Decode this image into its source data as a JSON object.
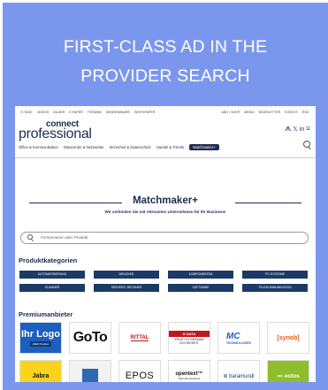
{
  "headline": {
    "line1": "FIRST-CLASS AD IN THE",
    "line2": "PROVIDER SEARCH"
  },
  "site": {
    "top_left": [
      "IT-TAGE",
      "VIDEOS",
      "BILDER",
      "E-PAPER",
      "TERMINE",
      "WEBSEMINARE",
      "WHITEPAPER"
    ],
    "top_right": [
      "ABO / SHOP",
      "MEDIA",
      "NEWSLETTER",
      "EVENTS",
      "RSS"
    ],
    "logo_top": "connect",
    "logo_bottom": "professional",
    "social": "⨇ 𝕏 in ✉",
    "nav": [
      "Office & Kommunikation",
      "Datacenter & Netzwerke",
      "Sicherheit & Datenschutz",
      "Handel & Trends",
      "Matchmaker+"
    ]
  },
  "matchmaker": {
    "title": "Matchmaker+",
    "subtitle": "Wir verbinden Sie mit relevanten Unternehmen für Ihr Business!",
    "search_placeholder": "Firmenname oder Produkt"
  },
  "categories": {
    "heading": "Produktkategorien",
    "items": [
      "AUTOMATISIERUNG",
      "DRUCKER",
      "KOMPONENTEN",
      "PC SYSTEME",
      "SCANNER",
      "SERVERS, RECHNER",
      "SOFTWARE",
      "TELEKOMMUNIKATION"
    ]
  },
  "premium": {
    "heading": "Premiumanbieter",
    "logos": {
      "ihr_logo": "Ihr Logo",
      "ihr_logo_sub": "HIER Position",
      "goto": "GoTo",
      "rittal": "RITTAL",
      "gdata_top": "G DATA",
      "gdata_text": "TRUST IN GERMAN SICHERHEIT",
      "mc": "MC",
      "mc_sub": "TECHNOLOGIES",
      "synology": "[synob]",
      "jabra": "Jabra",
      "epos": "EPOS",
      "opentext": "opentext™",
      "opentext_sub": "Security Solutions",
      "baramundi": "⊛ baramundi",
      "estos": "‹•› estos"
    }
  },
  "colors": {
    "frame": "#7b97ed",
    "navy": "#1d2c52",
    "button": "#1d3a66"
  }
}
